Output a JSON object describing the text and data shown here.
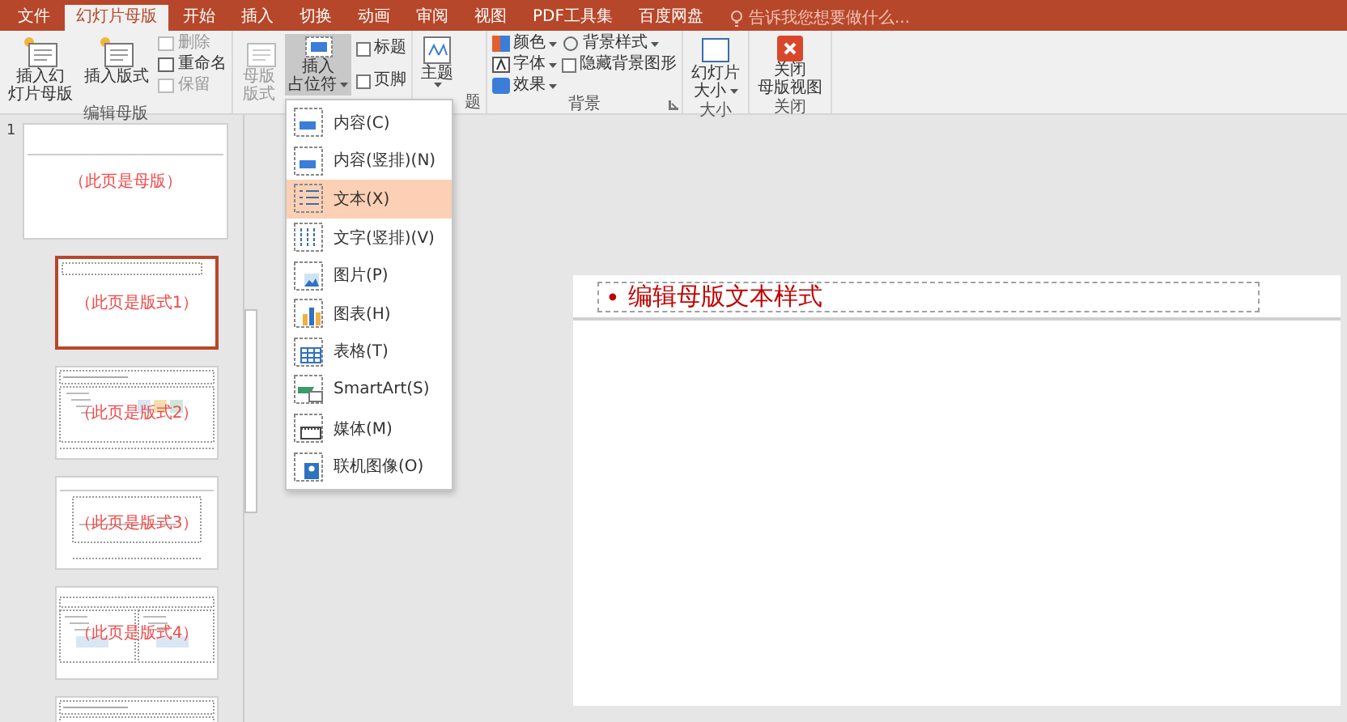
{
  "tabs": [
    {
      "label": "文件",
      "selected": false
    },
    {
      "label": "幻灯片母版",
      "selected": true
    },
    {
      "label": "开始",
      "selected": false
    },
    {
      "label": "插入",
      "selected": false
    },
    {
      "label": "切换",
      "selected": false
    },
    {
      "label": "动画",
      "selected": false
    },
    {
      "label": "审阅",
      "selected": false
    },
    {
      "label": "视图",
      "selected": false
    },
    {
      "label": "PDF工具集",
      "selected": false
    },
    {
      "label": "百度网盘",
      "selected": false
    }
  ],
  "search": {
    "placeholder": "告诉我您想要做什么..."
  },
  "ribbon": {
    "edit_master": {
      "label": "编辑母版",
      "insert_master": [
        "插入幻",
        "灯片母版"
      ],
      "insert_layout": "插入版式",
      "delete": {
        "label": "删除",
        "disabled": true
      },
      "rename": {
        "label": "重命名",
        "disabled": false
      },
      "preserve": {
        "label": "保留",
        "disabled": true
      }
    },
    "master_layout": {
      "layout_button": {
        "lines": [
          "母版",
          "版式"
        ],
        "disabled": true
      },
      "insert_placeholder": {
        "lines": [
          "插入",
          "占位符"
        ],
        "expanded": true
      },
      "title": {
        "label": "标题",
        "checked": false
      },
      "footer": {
        "label": "页脚",
        "checked": false
      }
    },
    "edit_theme": {
      "label": "题",
      "theme": "主题"
    },
    "background": {
      "label": "背景",
      "colors": "颜色",
      "fonts": "字体",
      "effects": "效果",
      "background_styles": "背景样式",
      "hide_background": {
        "label": "隐藏背景图形",
        "checked": false
      }
    },
    "size": {
      "label": "大小",
      "slide_size": [
        "幻灯片",
        "大小"
      ]
    },
    "close": {
      "label": "关闭",
      "close_master": [
        "关闭",
        "母版视图"
      ]
    }
  },
  "placeholder_menu": [
    {
      "label": "内容(C)",
      "kind": "content",
      "selected": false
    },
    {
      "label": "内容(竖排)(N)",
      "kind": "content",
      "selected": false
    },
    {
      "label": "文本(X)",
      "kind": "text",
      "selected": true
    },
    {
      "label": "文字(竖排)(V)",
      "kind": "vtext",
      "selected": false
    },
    {
      "label": "图片(P)",
      "kind": "picture",
      "selected": false
    },
    {
      "label": "图表(H)",
      "kind": "chart",
      "selected": false
    },
    {
      "label": "表格(T)",
      "kind": "table",
      "selected": false
    },
    {
      "label": "SmartArt(S)",
      "kind": "smartart",
      "selected": false
    },
    {
      "label": "媒体(M)",
      "kind": "media",
      "selected": false
    },
    {
      "label": "联机图像(O)",
      "kind": "online",
      "selected": false
    }
  ],
  "thumbnails": [
    {
      "number": "1",
      "caption": "（此页是母版）",
      "kind": "master",
      "selected": false
    },
    {
      "caption": "（此页是版式1）",
      "kind": "title",
      "selected": true
    },
    {
      "caption": "（此页是版式2）",
      "kind": "content",
      "selected": false
    },
    {
      "caption": "（此页是版式3）",
      "kind": "section",
      "selected": false
    },
    {
      "caption": "（此页是版式4）",
      "kind": "two",
      "selected": false
    },
    {
      "kind": "content",
      "selected": false
    }
  ],
  "slide": {
    "bullet": "•",
    "text": "编辑母版文本样式"
  }
}
